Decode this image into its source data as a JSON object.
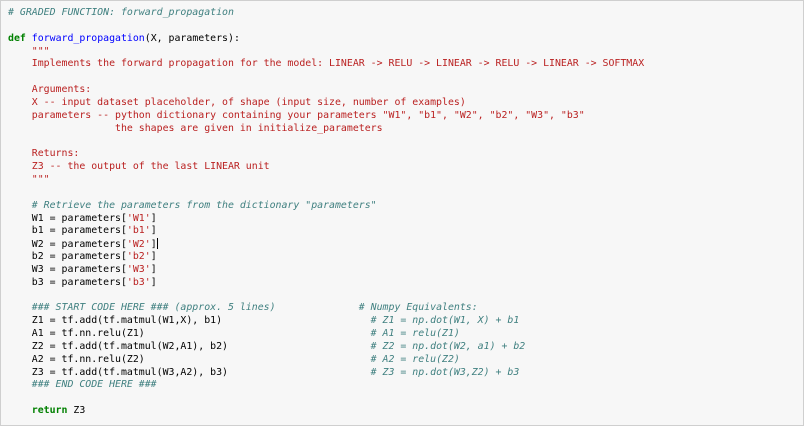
{
  "lines": {
    "l1": "# GRADED FUNCTION: forward_propagation",
    "l3_kw": "def",
    "l3_fn": "forward_propagation",
    "l3_rest": "(X, parameters):",
    "l4": "    \"\"\"",
    "l5": "    Implements the forward propagation for the model: LINEAR -> RELU -> LINEAR -> RELU -> LINEAR -> SOFTMAX",
    "l7": "    Arguments:",
    "l8": "    X -- input dataset placeholder, of shape (input size, number of examples)",
    "l9": "    parameters -- python dictionary containing your parameters \"W1\", \"b1\", \"W2\", \"b2\", \"W3\", \"b3\"",
    "l10": "                  the shapes are given in initialize_parameters",
    "l12": "    Returns:",
    "l13": "    Z3 -- the output of the last LINEAR unit",
    "l14": "    \"\"\"",
    "l16": "    # Retrieve the parameters from the dictionary \"parameters\"",
    "l17_a": "    W1 = parameters[",
    "l17_s": "'W1'",
    "l17_b": "]",
    "l18_a": "    b1 = parameters[",
    "l18_s": "'b1'",
    "l18_b": "]",
    "l19_a": "    W2 = parameters[",
    "l19_s": "'W2'",
    "l19_b": "]",
    "l20_a": "    b2 = parameters[",
    "l20_s": "'b2'",
    "l20_b": "]",
    "l21_a": "    W3 = parameters[",
    "l21_s": "'W3'",
    "l21_b": "]",
    "l22_a": "    b3 = parameters[",
    "l22_s": "'b3'",
    "l22_b": "]",
    "l24_a": "    ",
    "l24_c1": "### START CODE HERE ### (approx. 5 lines)",
    "l24_pad": "              ",
    "l24_c2": "# Numpy Equivalents:",
    "l25_a": "    Z1 = tf.add(tf.matmul(W1,X), b1)",
    "l25_pad": "                         ",
    "l25_c": "# Z1 = np.dot(W1, X) + b1",
    "l26_a": "    A1 = tf.nn.relu(Z1)",
    "l26_pad": "                                      ",
    "l26_c": "# A1 = relu(Z1)",
    "l27_a": "    Z2 = tf.add(tf.matmul(W2,A1), b2)",
    "l27_pad": "                        ",
    "l27_c": "# Z2 = np.dot(W2, a1) + b2",
    "l28_a": "    A2 = tf.nn.relu(Z2)",
    "l28_pad": "                                      ",
    "l28_c": "# A2 = relu(Z2)",
    "l29_a": "    Z3 = tf.add(tf.matmul(W3,A2), b3)",
    "l29_pad": "                        ",
    "l29_c": "# Z3 = np.dot(W3,Z2) + b3",
    "l30_a": "    ",
    "l30_c": "### END CODE HERE ###",
    "l32_a": "    ",
    "l32_kw": "return",
    "l32_b": " Z3"
  }
}
